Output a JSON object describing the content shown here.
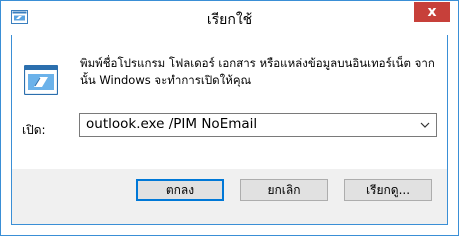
{
  "window": {
    "title": "เรียกใช้",
    "close_glyph": "x"
  },
  "dialog": {
    "description": "พิมพ์ชื่อโปรแกรม โฟลเดอร์ เอกสาร หรือแหล่งข้อมูลบนอินเทอร์เน็ต จากนั้น Windows จะทำการเปิดให้คุณ",
    "open_label": "เปิด:",
    "open_value": "outlook.exe /PIM NoEmail"
  },
  "buttons": {
    "ok": "ตกลง",
    "cancel": "ยกเลิก",
    "browse": "เรียกดู..."
  },
  "colors": {
    "accent": "#3a8fd6",
    "close": "#c7403a"
  },
  "icons": {
    "title": "run-icon",
    "main": "run-icon",
    "dropdown": "chevron-down-icon"
  }
}
